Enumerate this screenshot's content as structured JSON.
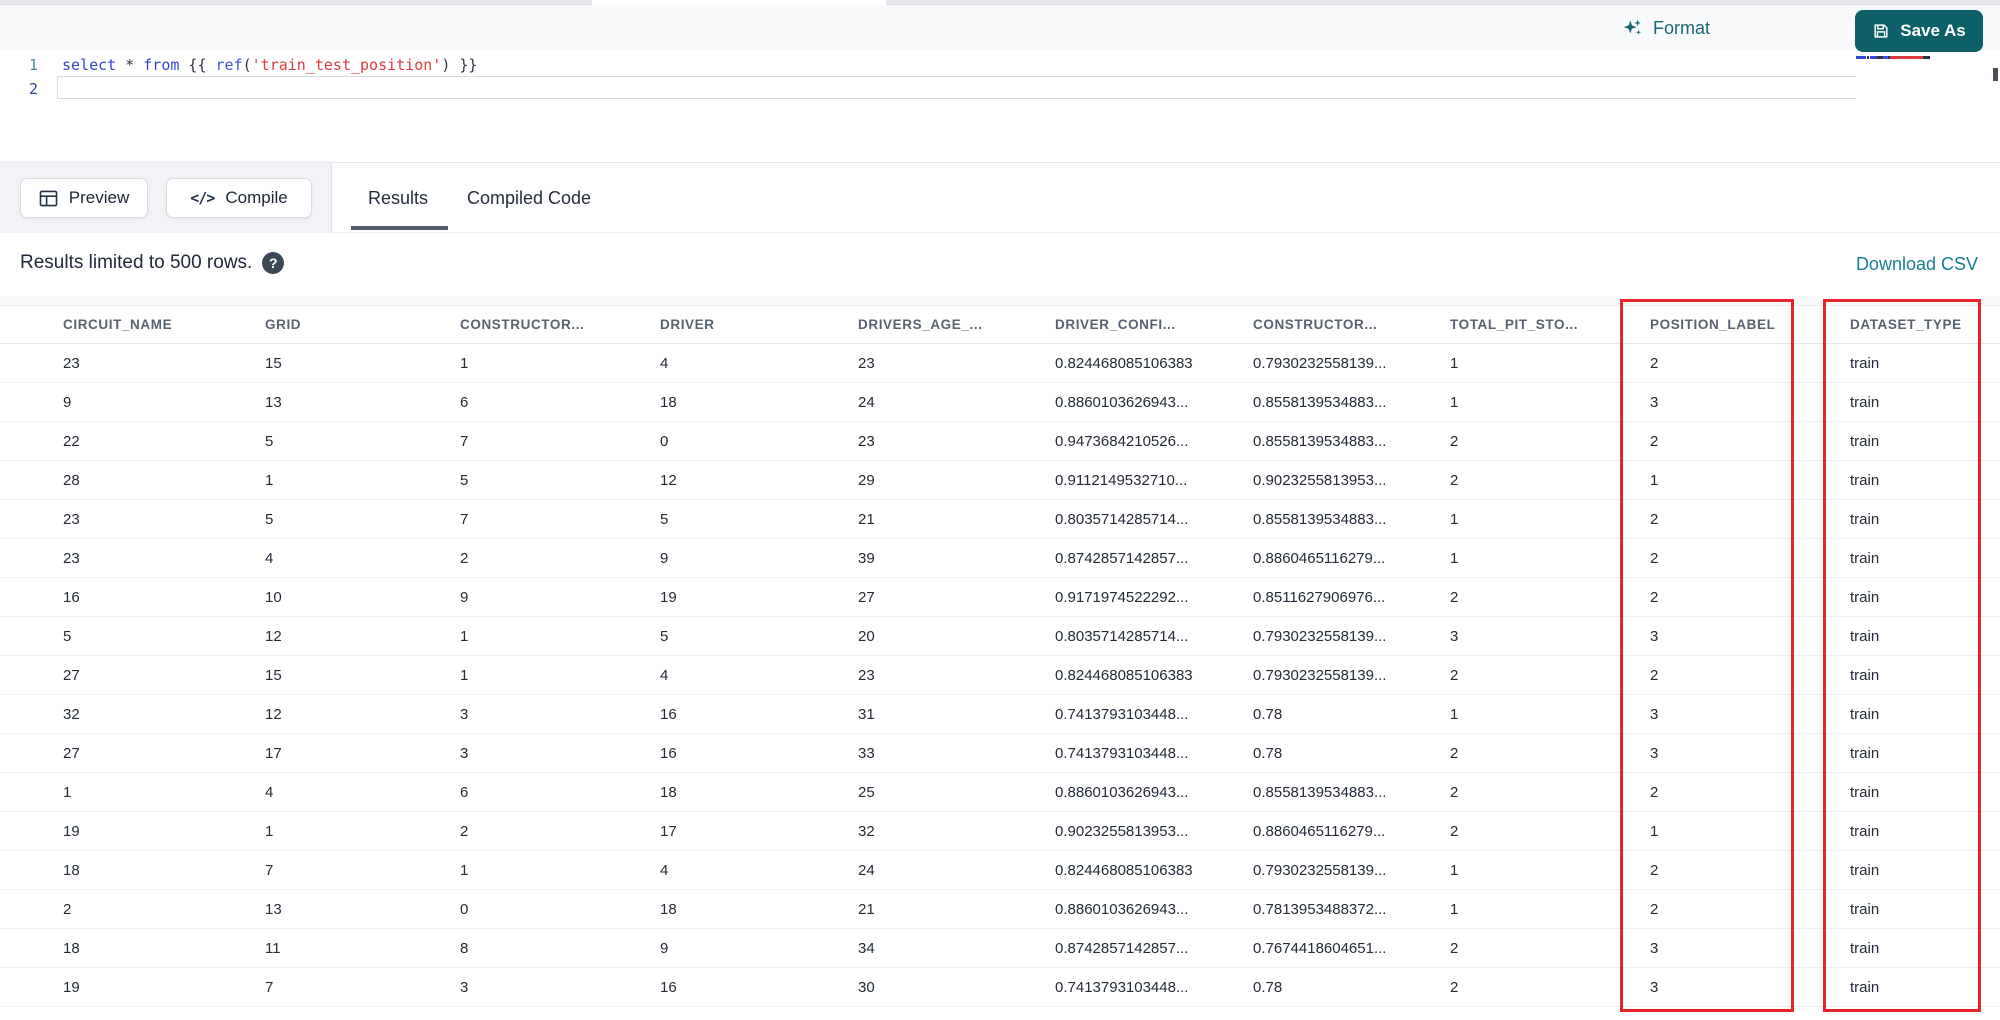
{
  "editor": {
    "line_numbers": [
      "1",
      "2"
    ],
    "sql_tokens": [
      {
        "text": "select",
        "type": "keyword"
      },
      {
        "text": " ",
        "type": "plain"
      },
      {
        "text": "*",
        "type": "operator"
      },
      {
        "text": " ",
        "type": "plain"
      },
      {
        "text": "from",
        "type": "keyword"
      },
      {
        "text": " {{ ",
        "type": "plain"
      },
      {
        "text": "ref",
        "type": "function"
      },
      {
        "text": "(",
        "type": "plain"
      },
      {
        "text": "'train_test_position'",
        "type": "string"
      },
      {
        "text": ") }}",
        "type": "plain"
      }
    ],
    "format_label": "Format",
    "save_as_label": "Save As"
  },
  "toolbar": {
    "preview_label": "Preview",
    "compile_label": "Compile",
    "compile_glyph": "</>",
    "tabs": [
      {
        "label": "Results",
        "active": true
      },
      {
        "label": "Compiled Code",
        "active": false
      }
    ]
  },
  "results_bar": {
    "limit_text": "Results limited to 500 rows.",
    "help_glyph": "?",
    "download_label": "Download CSV"
  },
  "table": {
    "columns": [
      "CIRCUIT_NAME",
      "GRID",
      "CONSTRUCTOR...",
      "DRIVER",
      "DRIVERS_AGE_...",
      "DRIVER_CONFI...",
      "CONSTRUCTOR...",
      "TOTAL_PIT_STO...",
      "POSITION_LABEL",
      "DATASET_TYPE"
    ],
    "rows": [
      [
        "23",
        "15",
        "1",
        "4",
        "23",
        "0.824468085106383",
        "0.7930232558139...",
        "1",
        "2",
        "train"
      ],
      [
        "9",
        "13",
        "6",
        "18",
        "24",
        "0.8860103626943...",
        "0.8558139534883...",
        "1",
        "3",
        "train"
      ],
      [
        "22",
        "5",
        "7",
        "0",
        "23",
        "0.9473684210526...",
        "0.8558139534883...",
        "2",
        "2",
        "train"
      ],
      [
        "28",
        "1",
        "5",
        "12",
        "29",
        "0.9112149532710...",
        "0.9023255813953...",
        "2",
        "1",
        "train"
      ],
      [
        "23",
        "5",
        "7",
        "5",
        "21",
        "0.8035714285714...",
        "0.8558139534883...",
        "1",
        "2",
        "train"
      ],
      [
        "23",
        "4",
        "2",
        "9",
        "39",
        "0.8742857142857...",
        "0.8860465116279...",
        "1",
        "2",
        "train"
      ],
      [
        "16",
        "10",
        "9",
        "19",
        "27",
        "0.9171974522292...",
        "0.8511627906976...",
        "2",
        "2",
        "train"
      ],
      [
        "5",
        "12",
        "1",
        "5",
        "20",
        "0.8035714285714...",
        "0.7930232558139...",
        "3",
        "3",
        "train"
      ],
      [
        "27",
        "15",
        "1",
        "4",
        "23",
        "0.824468085106383",
        "0.7930232558139...",
        "2",
        "2",
        "train"
      ],
      [
        "32",
        "12",
        "3",
        "16",
        "31",
        "0.7413793103448...",
        "0.78",
        "1",
        "3",
        "train"
      ],
      [
        "27",
        "17",
        "3",
        "16",
        "33",
        "0.7413793103448...",
        "0.78",
        "2",
        "3",
        "train"
      ],
      [
        "1",
        "4",
        "6",
        "18",
        "25",
        "0.8860103626943...",
        "0.8558139534883...",
        "2",
        "2",
        "train"
      ],
      [
        "19",
        "1",
        "2",
        "17",
        "32",
        "0.9023255813953...",
        "0.8860465116279...",
        "2",
        "1",
        "train"
      ],
      [
        "18",
        "7",
        "1",
        "4",
        "24",
        "0.824468085106383",
        "0.7930232558139...",
        "1",
        "2",
        "train"
      ],
      [
        "2",
        "13",
        "0",
        "18",
        "21",
        "0.8860103626943...",
        "0.7813953488372...",
        "1",
        "2",
        "train"
      ],
      [
        "18",
        "11",
        "8",
        "9",
        "34",
        "0.8742857142857...",
        "0.7674418604651...",
        "2",
        "3",
        "train"
      ],
      [
        "19",
        "7",
        "3",
        "16",
        "30",
        "0.7413793103448...",
        "0.78",
        "2",
        "3",
        "train"
      ]
    ],
    "highlighted_columns": [
      "POSITION_LABEL",
      "DATASET_TYPE"
    ]
  },
  "colors": {
    "teal": "#0d5f68",
    "teal_text": "#176971",
    "link": "#17808f",
    "red": "#e8232a",
    "keyword": "#3346d3",
    "function": "#4153d9",
    "string": "#df3a3f",
    "line_number_1": "#4b8b9b",
    "line_number_2": "#2f3f8f"
  }
}
